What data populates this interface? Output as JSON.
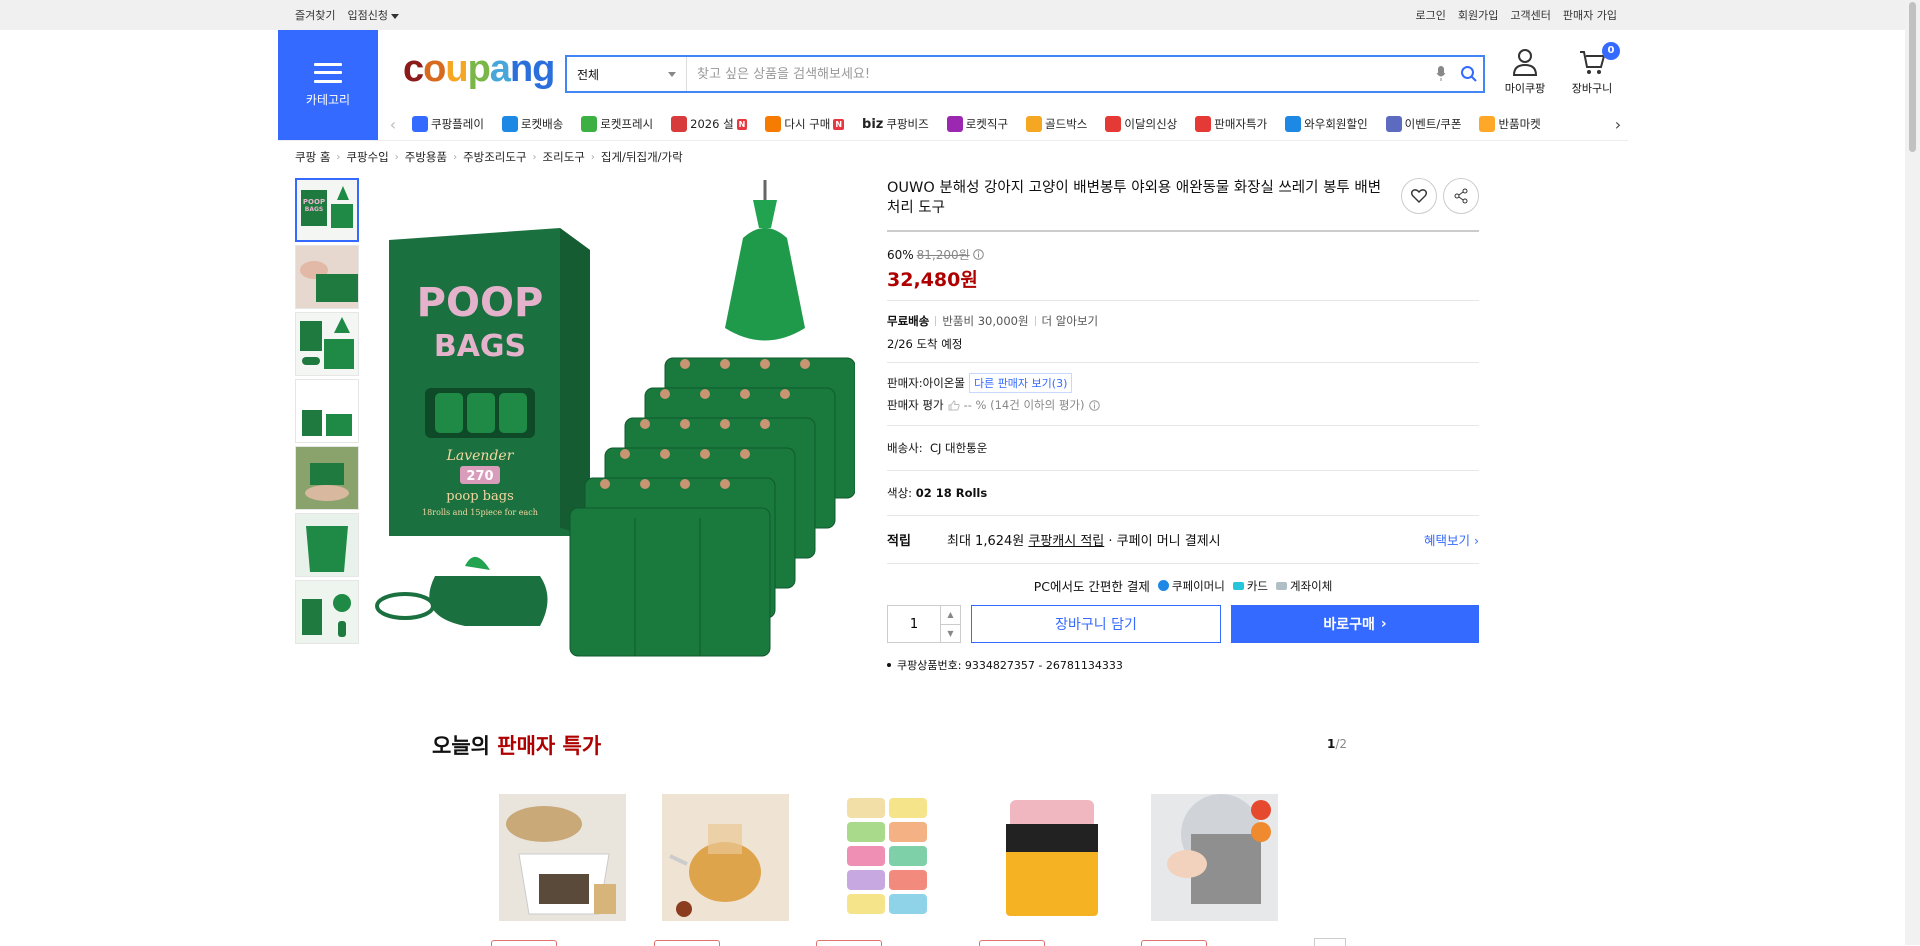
{
  "topbar": {
    "left": [
      "즐겨찾기",
      "입점신청"
    ],
    "right": [
      "로그인",
      "회원가입",
      "고객센터",
      "판매자 가입"
    ]
  },
  "header": {
    "category_label": "카테고리",
    "logo": "coupang",
    "search": {
      "scope": "전체",
      "placeholder": "찾고 싶은 상품을 검색해보세요!"
    },
    "mycoupang_label": "마이쿠팡",
    "cart_label": "장바구니",
    "cart_count": "0"
  },
  "nav": [
    {
      "label": "쿠팡플레이",
      "color": "#346aff",
      "new": false
    },
    {
      "label": "로켓배송",
      "color": "#1e88e5",
      "new": false
    },
    {
      "label": "로켓프레시",
      "color": "#3cb043",
      "new": false
    },
    {
      "label": "2026 설",
      "color": "#d83b3b",
      "new": true
    },
    {
      "label": "다시 구매",
      "color": "#f57c00",
      "new": true
    },
    {
      "label": "쿠팡비즈",
      "color": "#222222",
      "new": false,
      "prefix": "biz"
    },
    {
      "label": "로켓직구",
      "color": "#9c27b0",
      "new": false
    },
    {
      "label": "골드박스",
      "color": "#f5a623",
      "new": false
    },
    {
      "label": "이달의신상",
      "color": "#e53935",
      "new": false
    },
    {
      "label": "판매자특가",
      "color": "#e53935",
      "new": false
    },
    {
      "label": "와우회원할인",
      "color": "#1e88e5",
      "new": false
    },
    {
      "label": "이벤트/쿠폰",
      "color": "#5c6bc0",
      "new": false
    },
    {
      "label": "반품마켓",
      "color": "#ffa726",
      "new": false
    }
  ],
  "breadcrumb": [
    "쿠팡 홈",
    "쿠팡수입",
    "주방용품",
    "주방조리도구",
    "조리도구",
    "집게/뒤집개/가락"
  ],
  "product": {
    "title": "OUWO 분해성 강아지 고양이 배변봉투 야외용 애완동물 화장실 쓰레기 봉투 배변 처리 도구",
    "discount_rate": "60%",
    "original_price": "81,200원",
    "final_price": "32,480원",
    "shipping_free": "무료배송",
    "return_fee": "반품비 30,000원",
    "more": "더 알아보기",
    "arrival": "2/26 도착 예정",
    "seller_label": "판매자:",
    "seller_name": "아이온몰",
    "other_sellers": "다른 판매자 보기(3)",
    "seller_rating_label": "판매자 평가",
    "seller_rating_value": "-- % (14건 이하의 평가)",
    "courier_label": "배송사:",
    "courier": "CJ 대한통운",
    "color_label": "색상:",
    "color_value": "02 18 Rolls",
    "points_label": "적립",
    "points_text": "최대 1,624원",
    "points_link": "쿠팡캐시 적립",
    "points_suffix": "· 쿠페이 머니 결제시",
    "benefit": "혜택보기",
    "pc_pay": "PC에서도 간편한 결제",
    "pay_methods": [
      "쿠페이머니",
      "카드",
      "계좌이체"
    ],
    "quantity": "1",
    "cart_button": "장바구니 담기",
    "buy_button": "바로구매",
    "product_number": "쿠팡상품번호: 9334827357 - 26781134333",
    "image_text": {
      "line1": "POOP",
      "line2": "BAGS",
      "scent": "Lavender",
      "count": "270",
      "subtitle": "poop bags",
      "detail": "18rolls and 15piece for each"
    }
  },
  "deals": {
    "title_prefix": "오늘의",
    "title_highlight": "판매자 특가",
    "page_current": "1",
    "page_total": "/2",
    "items": [
      "rice-container",
      "glass-teapot",
      "tea-tins",
      "rust-eraser",
      "scrub-cloth"
    ]
  },
  "colors": {
    "accent": "#346aff",
    "price": "#ae0000",
    "product_green": "#1e7a3e"
  }
}
